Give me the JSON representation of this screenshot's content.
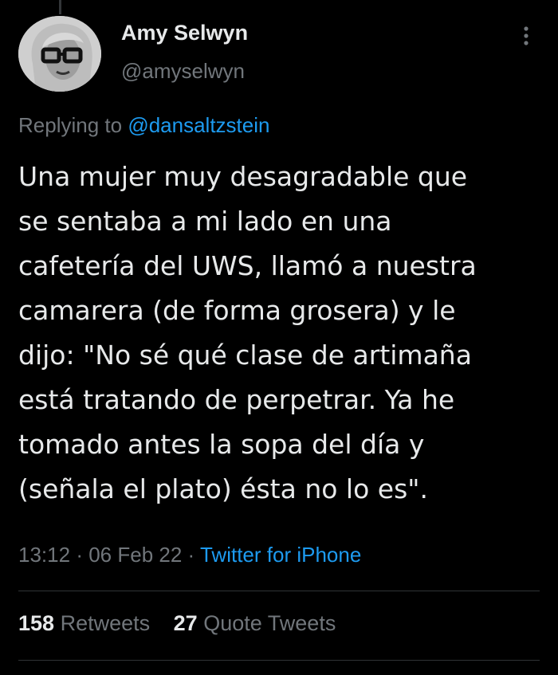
{
  "tweet": {
    "author": {
      "name": "Amy Selwyn",
      "handle": "@amyselwyn"
    },
    "reply": {
      "prefix": "Replying to",
      "mention": "@dansaltzstein"
    },
    "lines": [
      "Una mujer muy desagradable que",
      "se sentaba a mi lado en una",
      "cafetería del UWS, llamó a nuestra",
      "camarera (de forma grosera) y le",
      "dijo: \"No sé qué clase de artimaña",
      "está tratando de perpetrar. Ya he",
      "tomado antes la sopa del día y",
      "(señala el plato) ésta no lo es\"."
    ],
    "time": "13:12",
    "date": "06 Feb 22",
    "separator": "·",
    "source": "Twitter for iPhone",
    "stats": {
      "retweets_count": "158",
      "retweets_label": "Retweets",
      "quotes_count": "27",
      "quotes_label": "Quote Tweets"
    }
  },
  "icons": {
    "more": "more-vertical-icon",
    "avatar": "profile-photo"
  },
  "colors": {
    "background": "#000000",
    "text": "#e7e9ea",
    "secondary": "#71767b",
    "link": "#1d9bf0",
    "divider": "#2f3336"
  }
}
